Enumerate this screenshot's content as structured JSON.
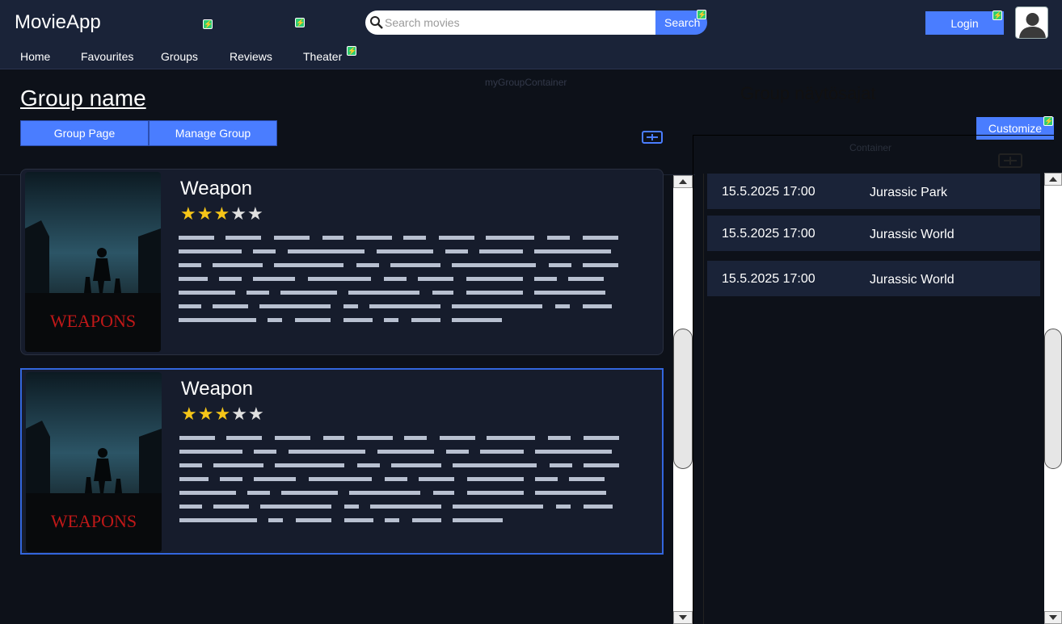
{
  "header": {
    "app_title": "MovieApp",
    "search_placeholder": "Search movies",
    "search_label": "Search",
    "login_label": "Login",
    "nav": [
      {
        "label": "Home"
      },
      {
        "label": "Favourites"
      },
      {
        "label": "Groups"
      },
      {
        "label": "Reviews"
      },
      {
        "label": "Theater"
      }
    ]
  },
  "main": {
    "container_label": "myGroupContainer",
    "group_title": "Group name",
    "group_page_label": "Group Page",
    "manage_group_label": "Manage Group",
    "movies": [
      {
        "title": "Weapon",
        "rating": 3,
        "max_rating": 5,
        "poster_text": "WEAPONS"
      },
      {
        "title": "Weapon",
        "rating": 3,
        "max_rating": 5,
        "poster_text": "WEAPONS"
      }
    ]
  },
  "sidebar": {
    "title": "Group näytösajat",
    "customize_label": "Customize",
    "container_label": "Container",
    "showtimes": [
      {
        "time": "15.5.2025 17:00",
        "movie": "Jurassic Park"
      },
      {
        "time": "15.5.2025 17:00",
        "movie": "Jurassic World"
      },
      {
        "time": "15.5.2025 17:00",
        "movie": "Jurassic World"
      }
    ]
  },
  "colors": {
    "accent": "#4a7dff",
    "header_bg": "#1a2338",
    "page_bg": "#0d1119",
    "star": "#f5c518"
  }
}
